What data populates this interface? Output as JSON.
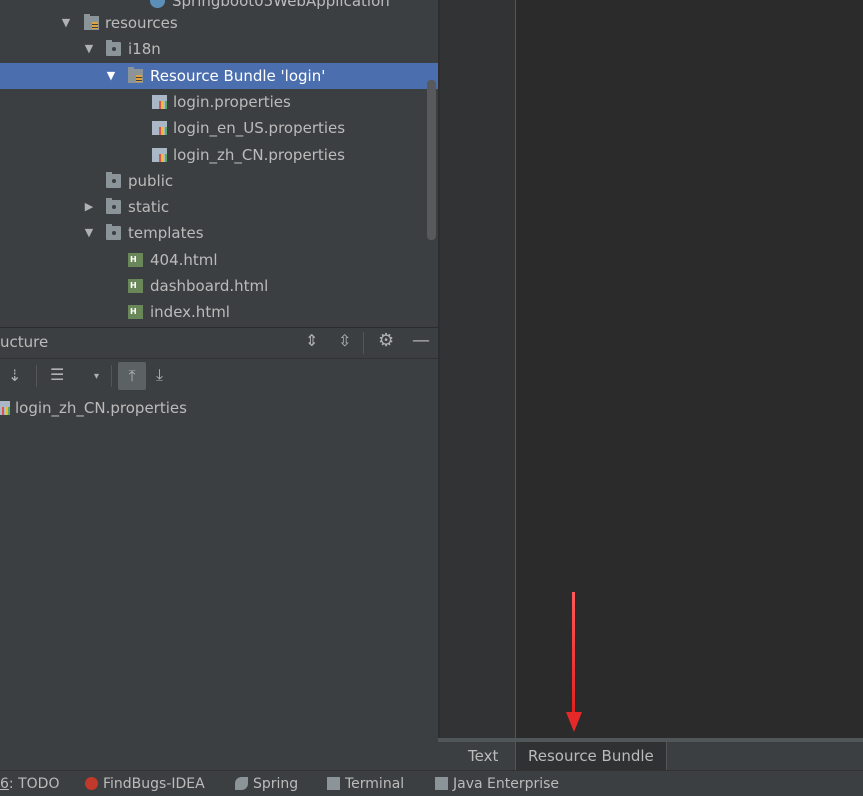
{
  "project_tree": {
    "partial_top_item": "Springboot05WebApplication",
    "rows": [
      {
        "label": "resources",
        "expanded": true
      },
      {
        "label": "i18n",
        "expanded": true
      },
      {
        "label": "Resource Bundle 'login'",
        "expanded": true,
        "selected": true
      },
      {
        "label": "login.properties"
      },
      {
        "label": "login_en_US.properties"
      },
      {
        "label": "login_zh_CN.properties"
      },
      {
        "label": "public"
      },
      {
        "label": "static",
        "expanded": false
      },
      {
        "label": "templates",
        "expanded": true
      },
      {
        "label": "404.html"
      },
      {
        "label": "dashboard.html"
      },
      {
        "label": "index.html"
      }
    ]
  },
  "structure": {
    "title_partial": "ucture",
    "item": "login_zh_CN.properties"
  },
  "editor_tabs": {
    "text": "Text",
    "resource_bundle": "Resource Bundle"
  },
  "tool_windows": {
    "todo_num": "6",
    "todo": ": TODO",
    "findbugs": "FindBugs-IDEA",
    "spring": "Spring",
    "terminal": "Terminal",
    "java_enterprise": "Java Enterprise"
  },
  "colors": {
    "selection": "#4b6eaf",
    "annotation_arrow": "#e52929"
  }
}
